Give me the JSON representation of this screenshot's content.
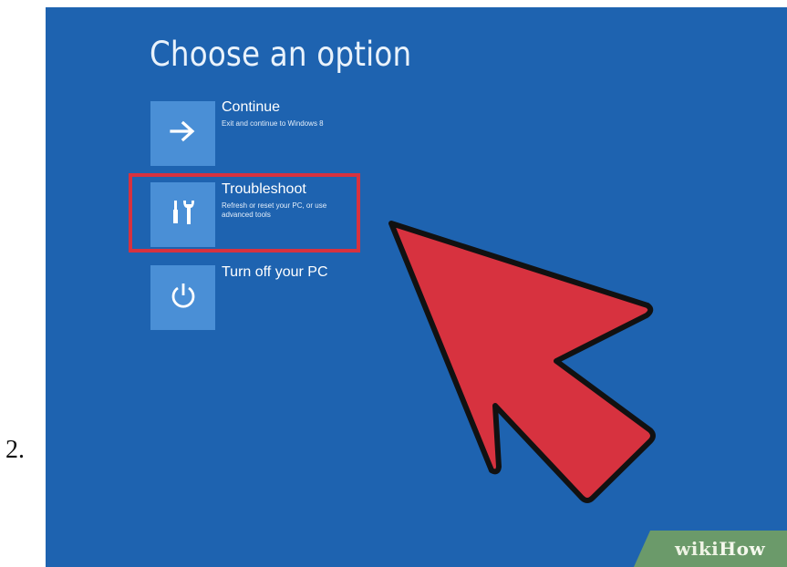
{
  "step": {
    "number": "2."
  },
  "screen": {
    "title": "Choose an option",
    "options": [
      {
        "label": "Continue",
        "description": "Exit and continue to Windows 8",
        "icon": "arrow-right-icon"
      },
      {
        "label": "Troubleshoot",
        "description": "Refresh or reset your PC, or use advanced tools",
        "icon": "tools-icon"
      },
      {
        "label": "Turn off your PC",
        "description": "",
        "icon": "power-icon"
      }
    ],
    "highlighted_option": "Troubleshoot"
  },
  "pointer": {
    "icon": "cursor-arrow-icon",
    "color": "#d7323f"
  },
  "watermark": {
    "part1": "wiki",
    "part2": "How"
  },
  "colors": {
    "background": "#1e63b0",
    "tile": "#4a8fd6",
    "highlight": "#d7323f",
    "watermark_band": "#6b9a6a"
  }
}
